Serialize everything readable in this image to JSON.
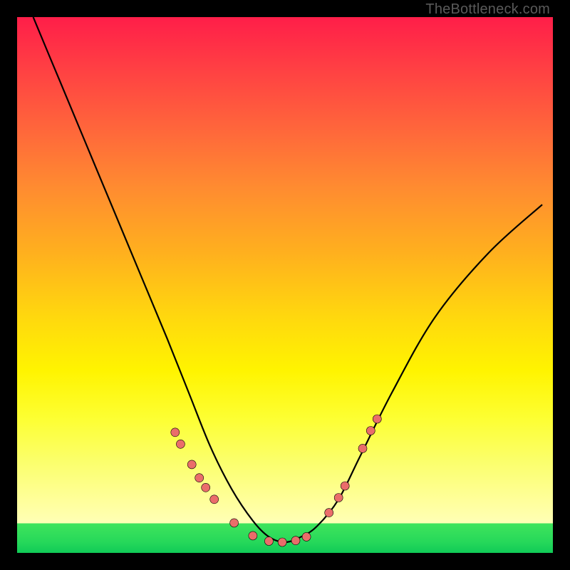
{
  "watermark": "TheBottleneck.com",
  "colors": {
    "gradient_top": "#ff1e49",
    "gradient_mid": "#ffe800",
    "gradient_band_pale": "#ffffb0",
    "gradient_green": "#20d058",
    "curve": "#000000",
    "bead_fill": "#ea6d6a",
    "bead_stroke": "#000000",
    "frame": "#000000"
  },
  "chart_data": {
    "type": "line",
    "title": "",
    "xlabel": "",
    "ylabel": "",
    "xlim": [
      0,
      100
    ],
    "ylim": [
      0,
      100
    ],
    "grid": false,
    "series": [
      {
        "name": "bottleneck-curve",
        "x": [
          3,
          8,
          13,
          18,
          23,
          28,
          32,
          36,
          40,
          44,
          47,
          50,
          53,
          56,
          60,
          64,
          70,
          78,
          88,
          98
        ],
        "y": [
          100,
          88,
          76,
          64,
          52,
          40,
          30,
          20,
          12,
          6,
          3,
          2,
          3,
          5,
          10,
          18,
          30,
          44,
          56,
          65
        ]
      }
    ],
    "annotations": {
      "beads": [
        {
          "x": 29.5,
          "y": 22.5
        },
        {
          "x": 30.5,
          "y": 20.3
        },
        {
          "x": 32.6,
          "y": 16.5
        },
        {
          "x": 34.0,
          "y": 14.0
        },
        {
          "x": 35.2,
          "y": 12.2
        },
        {
          "x": 36.8,
          "y": 10.0
        },
        {
          "x": 40.5,
          "y": 5.6
        },
        {
          "x": 44.0,
          "y": 3.2
        },
        {
          "x": 47.0,
          "y": 2.2
        },
        {
          "x": 49.5,
          "y": 2.0
        },
        {
          "x": 52.0,
          "y": 2.3
        },
        {
          "x": 54.0,
          "y": 3.0
        },
        {
          "x": 58.2,
          "y": 7.5
        },
        {
          "x": 60.0,
          "y": 10.3
        },
        {
          "x": 61.2,
          "y": 12.5
        },
        {
          "x": 64.5,
          "y": 19.5
        },
        {
          "x": 66.0,
          "y": 22.8
        },
        {
          "x": 67.2,
          "y": 25.0
        }
      ],
      "bead_radius": 6
    }
  }
}
